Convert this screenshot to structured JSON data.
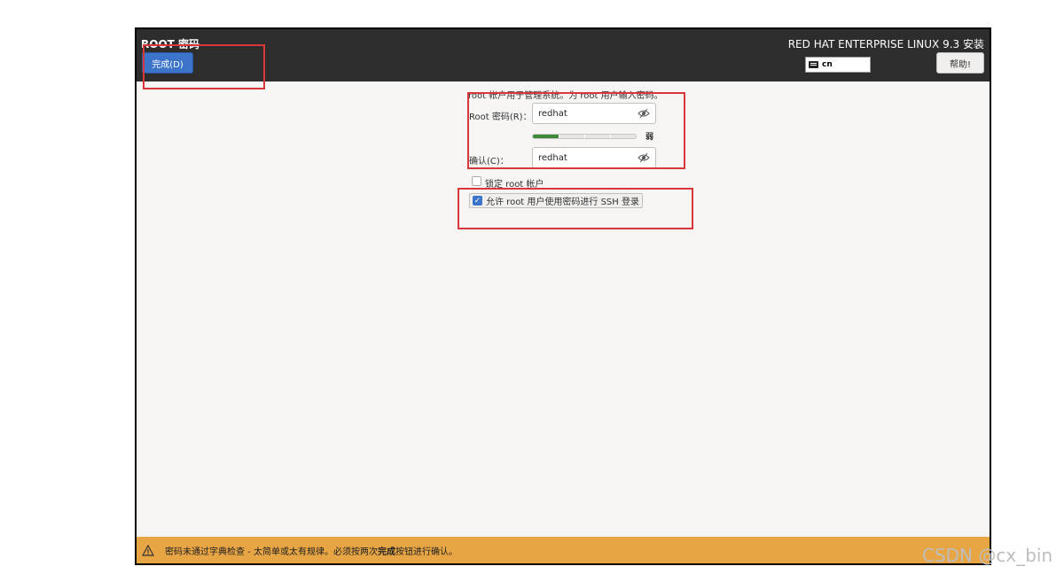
{
  "header": {
    "title": "ROOT 密码",
    "done_label": "完成(D)",
    "product": "RED HAT ENTERPRISE LINUX 9.3 安装",
    "keyboard_layout": "cn",
    "help_label": "帮助!"
  },
  "form": {
    "intro": "root 帐户用于管理系统。为 root 用户输入密码。",
    "root_password_label": "Root 密码(R)：",
    "root_password_value": "redhat",
    "strength_fraction": 0.25,
    "strength_word": "弱",
    "confirm_label": "确认(C)：",
    "confirm_value": "redhat",
    "lock_root_label": "锁定 root 帐户",
    "lock_root_checked": false,
    "allow_ssh_label": "允许 root 用户使用密码进行 SSH 登录",
    "allow_ssh_checked": true
  },
  "footer": {
    "warning_prefix": "密码未通过字典检查 - 太简单或太有规律。必须按两次",
    "warning_bold": "完成",
    "warning_suffix": "按钮进行确认。"
  },
  "watermark": "CSDN @cx_bin",
  "colors": {
    "header_bg": "#2d2d2d",
    "accent": "#3b74c9",
    "footer_bg": "#e8a544",
    "annotation": "#d9383b",
    "strength_fill": "#3f8a3a"
  },
  "icons": [
    "keyboard-icon",
    "eye-slash-icon",
    "checkmark-icon",
    "warning-icon"
  ]
}
